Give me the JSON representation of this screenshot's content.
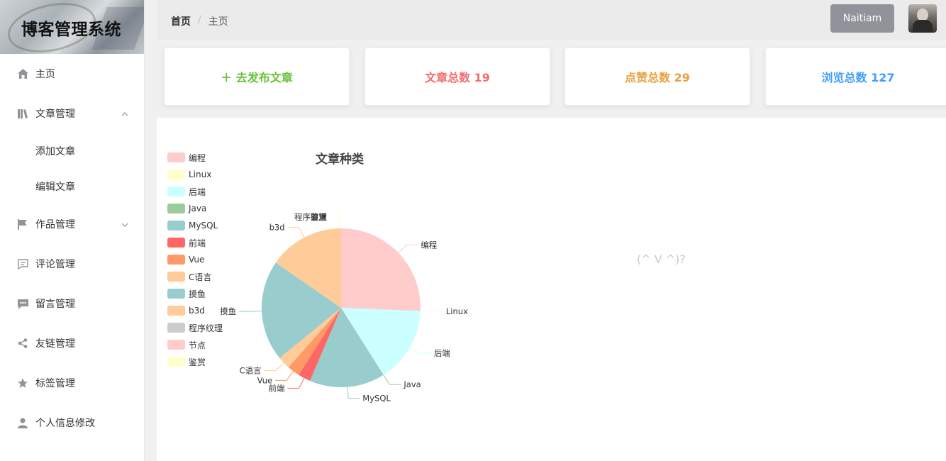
{
  "sidebar": {
    "title": "博客管理系统",
    "items": [
      {
        "name": "menu-item-home",
        "label": "主页",
        "icon": "home-icon"
      },
      {
        "name": "menu-item-articles",
        "label": "文章管理",
        "icon": "book-icon",
        "expanded": true,
        "children": [
          {
            "label": "添加文章"
          },
          {
            "label": "编辑文章"
          }
        ]
      },
      {
        "name": "menu-item-works",
        "label": "作品管理",
        "icon": "flag-icon",
        "expanded": false
      },
      {
        "name": "menu-item-comments",
        "label": "评论管理",
        "icon": "comment-icon"
      },
      {
        "name": "menu-item-messages",
        "label": "留言管理",
        "icon": "message-icon"
      },
      {
        "name": "menu-item-links",
        "label": "友链管理",
        "icon": "share-icon"
      },
      {
        "name": "menu-item-tags",
        "label": "标签管理",
        "icon": "star-icon"
      },
      {
        "name": "menu-item-profile",
        "label": "个人信息修改",
        "icon": "user-icon"
      }
    ]
  },
  "header": {
    "breadcrumb_home": "首页",
    "breadcrumb_sep": "/",
    "breadcrumb_current": "主页",
    "user_name": "Naitiam"
  },
  "cards": [
    {
      "label": "＋ 去发布文章",
      "color": "#67c23a"
    },
    {
      "label": "文章总数 19",
      "color": "#f56c6c"
    },
    {
      "label": "点赞总数 29",
      "color": "#e6a23c"
    },
    {
      "label": "浏览总数 127",
      "color": "#409eff"
    }
  ],
  "empty_text": "(^ V ^)?",
  "chart_data": {
    "type": "pie",
    "title": "文章种类",
    "legend_position": "left",
    "categories": [
      "编程",
      "Linux",
      "后端",
      "Java",
      "MySQL",
      "前端",
      "Vue",
      "C语言",
      "摸鱼",
      "b3d",
      "程序纹理",
      "节点",
      "鉴赏"
    ],
    "values": [
      5,
      0,
      3,
      0,
      3,
      0.5,
      0.5,
      0.5,
      4,
      3,
      0,
      0,
      0
    ],
    "colors": [
      "#ffcccc",
      "#ffffcc",
      "#ccffff",
      "#99cc99",
      "#99cccc",
      "#ff6666",
      "#ff9966",
      "#ffcc99",
      "#99cccc",
      "#ffcc99",
      "#cccccc",
      "#ffcccc",
      "#ffffcc"
    ]
  }
}
